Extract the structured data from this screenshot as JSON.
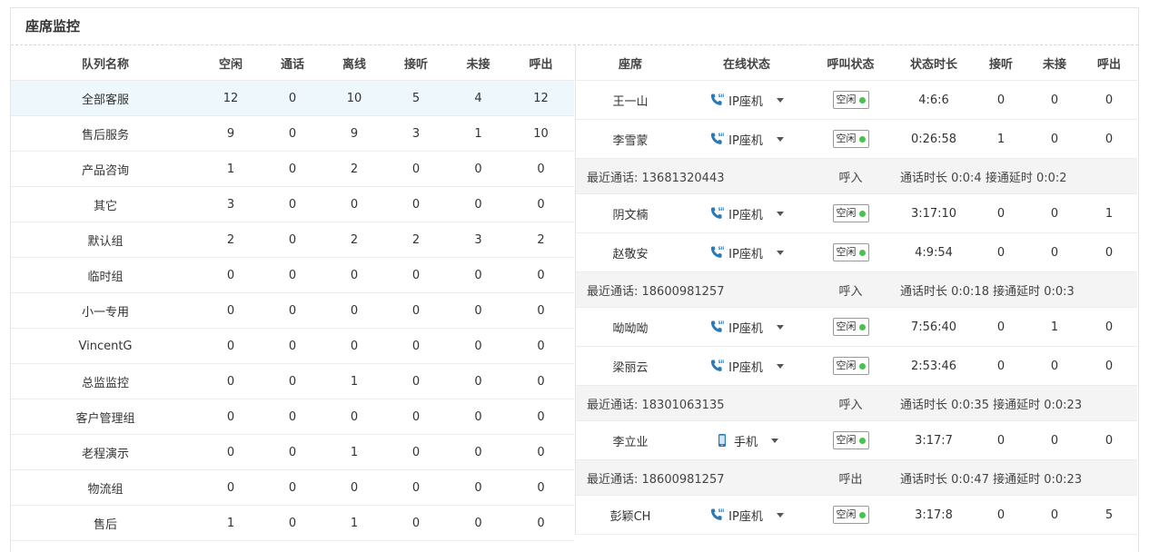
{
  "title": "座席监控",
  "colors": {
    "accent_select": "#eef7fc",
    "status_dot": "#4cc04c",
    "phone_icon": "#2a7ab8"
  },
  "queue_table": {
    "headers": [
      "队列名称",
      "空闲",
      "通话",
      "离线",
      "接听",
      "未接",
      "呼出"
    ],
    "rows": [
      [
        "全部客服",
        "12",
        "0",
        "10",
        "5",
        "4",
        "12"
      ],
      [
        "售后服务",
        "9",
        "0",
        "9",
        "3",
        "1",
        "10"
      ],
      [
        "产品咨询",
        "1",
        "0",
        "2",
        "0",
        "0",
        "0"
      ],
      [
        "其它",
        "3",
        "0",
        "0",
        "0",
        "0",
        "0"
      ],
      [
        "默认组",
        "2",
        "0",
        "2",
        "2",
        "3",
        "2"
      ],
      [
        "临时组",
        "0",
        "0",
        "0",
        "0",
        "0",
        "0"
      ],
      [
        "小一专用",
        "0",
        "0",
        "0",
        "0",
        "0",
        "0"
      ],
      [
        "VincentG",
        "0",
        "0",
        "0",
        "0",
        "0",
        "0"
      ],
      [
        "总监监控",
        "0",
        "0",
        "1",
        "0",
        "0",
        "0"
      ],
      [
        "客户管理组",
        "0",
        "0",
        "0",
        "0",
        "0",
        "0"
      ],
      [
        "老程演示",
        "0",
        "0",
        "1",
        "0",
        "0",
        "0"
      ],
      [
        "物流组",
        "0",
        "0",
        "0",
        "0",
        "0",
        "0"
      ],
      [
        "售后",
        "1",
        "0",
        "1",
        "0",
        "0",
        "0"
      ]
    ]
  },
  "agent_table": {
    "headers": [
      "座席",
      "在线状态",
      "呼叫状态",
      "状态时长",
      "接听",
      "未接",
      "呼出"
    ],
    "rows": [
      {
        "kind": "agent",
        "name": "王一山",
        "icon": "ip-phone-icon",
        "online": "IP座机",
        "call_status": "空闲",
        "duration": "4:6:6",
        "answered": "0",
        "missed": "0",
        "outgoing": "0"
      },
      {
        "kind": "agent",
        "name": "李雪蒙",
        "icon": "ip-phone-icon",
        "online": "IP座机",
        "call_status": "空闲",
        "duration": "0:26:58",
        "answered": "1",
        "missed": "0",
        "outgoing": "0"
      },
      {
        "kind": "call",
        "number": "最近通话: 13681320443",
        "direction": "呼入",
        "info": "通话时长 0:0:4 接通延时 0:0:2"
      },
      {
        "kind": "agent",
        "name": "阴文楠",
        "icon": "ip-phone-icon",
        "online": "IP座机",
        "call_status": "空闲",
        "duration": "3:17:10",
        "answered": "0",
        "missed": "0",
        "outgoing": "1"
      },
      {
        "kind": "agent",
        "name": "赵敬安",
        "icon": "ip-phone-icon",
        "online": "IP座机",
        "call_status": "空闲",
        "duration": "4:9:54",
        "answered": "0",
        "missed": "0",
        "outgoing": "0"
      },
      {
        "kind": "call",
        "number": "最近通话: 18600981257",
        "direction": "呼入",
        "info": "通话时长 0:0:18 接通延时 0:0:3"
      },
      {
        "kind": "agent",
        "name": "呦呦呦",
        "icon": "ip-phone-icon",
        "online": "IP座机",
        "call_status": "空闲",
        "duration": "7:56:40",
        "answered": "0",
        "missed": "1",
        "outgoing": "0"
      },
      {
        "kind": "agent",
        "name": "梁丽云",
        "icon": "ip-phone-icon",
        "online": "IP座机",
        "call_status": "空闲",
        "duration": "2:53:46",
        "answered": "0",
        "missed": "0",
        "outgoing": "0"
      },
      {
        "kind": "call",
        "number": "最近通话: 18301063135",
        "direction": "呼入",
        "info": "通话时长 0:0:35 接通延时 0:0:23"
      },
      {
        "kind": "agent",
        "name": "李立业",
        "icon": "mobile-phone-icon",
        "online": "手机",
        "call_status": "空闲",
        "duration": "3:17:7",
        "answered": "0",
        "missed": "0",
        "outgoing": "0"
      },
      {
        "kind": "call",
        "number": "最近通话: 18600981257",
        "direction": "呼出",
        "info": "通话时长 0:0:47 接通延时 0:0:23"
      },
      {
        "kind": "agent",
        "name": "彭颖CH",
        "icon": "ip-phone-icon",
        "online": "IP座机",
        "call_status": "空闲",
        "duration": "3:17:8",
        "answered": "0",
        "missed": "0",
        "outgoing": "5"
      }
    ]
  }
}
